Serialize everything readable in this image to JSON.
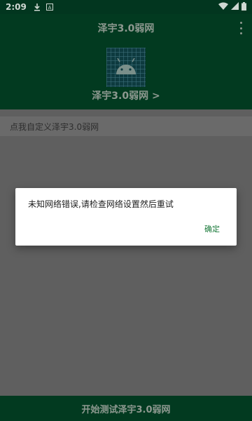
{
  "status_bar": {
    "time": "2:09",
    "icons_left": [
      "download-icon",
      "notification-a-icon"
    ],
    "icons_right": [
      "wifi-icon",
      "signal-icon",
      "battery-icon"
    ]
  },
  "app_bar": {
    "title": "泽宇3.0弱网",
    "menu_icon": "more-vert-icon"
  },
  "header": {
    "icon": "android-icon",
    "title": "泽宇3.0弱网 >"
  },
  "settings_row": {
    "label": "点我自定义泽宇3.0弱网"
  },
  "bottom_bar": {
    "label": "开始测试泽宇3.0弱网"
  },
  "dialog": {
    "message": "未知网络错误,请检查网络设置然后重试",
    "confirm_label": "确定"
  },
  "colors": {
    "primary_dark": "#02361f",
    "accent": "#1a7a3a",
    "scrim": "#5f5f5f"
  }
}
